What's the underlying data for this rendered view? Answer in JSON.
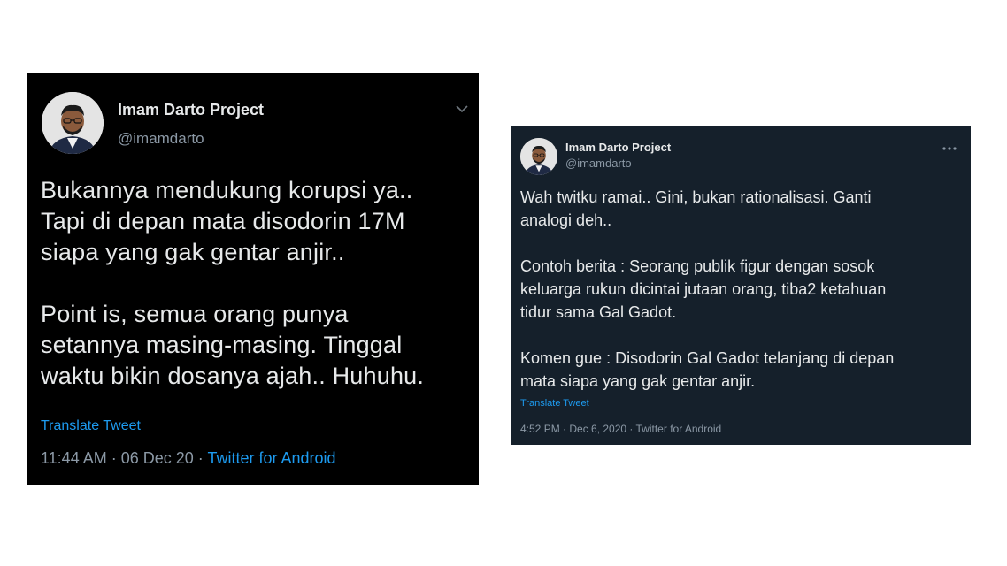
{
  "tweets": [
    {
      "display_name": "Imam Darto Project",
      "handle": "@imamdarto",
      "menu_icon": "chevron-down-icon",
      "text": "Bukannya mendukung korupsi ya..\nTapi di depan mata disodorin 17M\nsiapa yang gak gentar anjir..\n\nPoint is, semua orang punya\nsetannya masing-masing. Tinggal\nwaktu bikin dosanya ajah.. Huhuhu.",
      "translate_label": "Translate Tweet",
      "timestamp": "11:44 AM · 06 Dec 20 · ",
      "source": "Twitter for Android",
      "theme_bg": "#000000"
    },
    {
      "display_name": "Imam Darto Project",
      "handle": "@imamdarto",
      "menu_icon": "more-horizontal-icon",
      "text": "Wah twitku ramai.. Gini, bukan rationalisasi. Ganti\nanalogi deh..\n\nContoh berita : Seorang publik figur dengan sosok\nkeluarga rukun dicintai jutaan orang, tiba2 ketahuan\ntidur sama Gal Gadot.\n\nKomen gue : Disodorin Gal Gadot telanjang di depan\nmata siapa yang gak gentar anjir.",
      "translate_label": "Translate Tweet",
      "timestamp": "4:52 PM · Dec 6, 2020 · ",
      "source": "Twitter for Android",
      "theme_bg": "#15202b"
    }
  ],
  "colors": {
    "link": "#1d9bf0",
    "text": "#e7e9ea",
    "muted": "#8b98a5"
  }
}
